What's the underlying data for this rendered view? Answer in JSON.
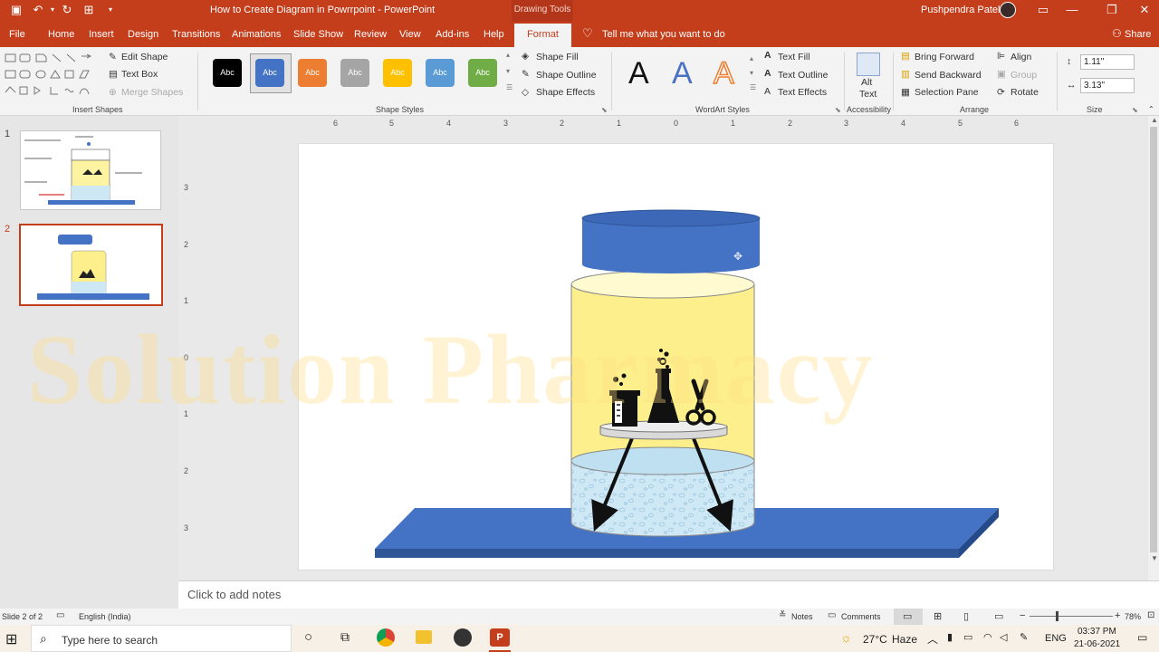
{
  "window": {
    "title": "How to Create Diagram in Powrrpoint  -  PowerPoint",
    "context_tab_group": "Drawing Tools",
    "user": "Pushpendra Patel"
  },
  "tabs": [
    "File",
    "Home",
    "Insert",
    "Design",
    "Transitions",
    "Animations",
    "Slide Show",
    "Review",
    "View",
    "Add-ins",
    "Help",
    "Format"
  ],
  "active_tab": "Format",
  "tell_me": "Tell me what you want to do",
  "share": "Share",
  "ribbon": {
    "insert_shapes": {
      "label": "Insert Shapes",
      "edit_shape": "Edit Shape",
      "text_box": "Text Box",
      "merge_shapes": "Merge Shapes"
    },
    "shape_styles": {
      "label": "Shape Styles",
      "swatch_text": "Abc",
      "colors": [
        "#000000",
        "#4472c4",
        "#ed7d31",
        "#a5a5a5",
        "#ffc000",
        "#5b9bd5",
        "#70ad47"
      ],
      "shape_fill": "Shape Fill",
      "shape_outline": "Shape Outline",
      "shape_effects": "Shape Effects"
    },
    "wordart_styles": {
      "label": "WordArt Styles",
      "glyph": "A",
      "text_fill": "Text Fill",
      "text_outline": "Text Outline",
      "text_effects": "Text Effects"
    },
    "accessibility": {
      "label": "Accessibility",
      "alt_text_1": "Alt",
      "alt_text_2": "Text"
    },
    "arrange": {
      "label": "Arrange",
      "bring_forward": "Bring Forward",
      "send_backward": "Send Backward",
      "selection_pane": "Selection Pane",
      "align": "Align",
      "group": "Group",
      "rotate": "Rotate"
    },
    "size": {
      "label": "Size",
      "height": "1.11\"",
      "width": "3.13\""
    }
  },
  "ruler": {
    "horizontal": [
      "6",
      "5",
      "4",
      "3",
      "2",
      "1",
      "0",
      "1",
      "2",
      "3",
      "4",
      "5",
      "6"
    ],
    "vertical": [
      "3",
      "2",
      "1",
      "0",
      "1",
      "2",
      "3"
    ]
  },
  "slides": [
    {
      "number": "1"
    },
    {
      "number": "2"
    }
  ],
  "watermark": "Solution Pharmacy",
  "notes_placeholder": "Click to add notes",
  "status": {
    "slide": "Slide 2 of 2",
    "language": "English (India)",
    "notes": "Notes",
    "comments": "Comments",
    "zoom": "78%"
  },
  "taskbar": {
    "search": "Type here to search",
    "temperature": "27°C",
    "weather": "Haze",
    "lang": "ENG",
    "time": "03:37 PM",
    "date": "21-06-2021"
  }
}
